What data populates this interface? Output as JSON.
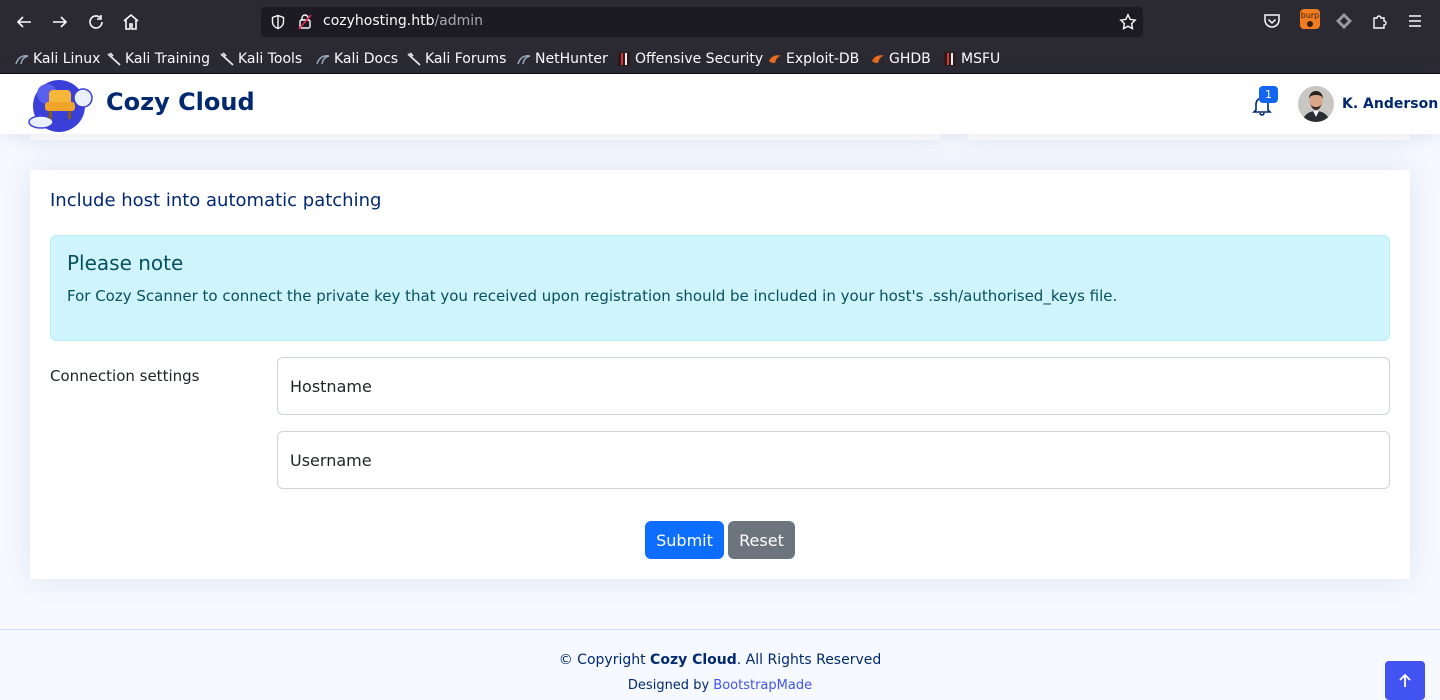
{
  "browser": {
    "url_host": "cozyhosting.htb",
    "url_path": "/admin",
    "bookmarks": [
      {
        "label": "Kali Linux",
        "icon": "kali-dragon-icon"
      },
      {
        "label": "Kali Training",
        "icon": "kali-dragon-icon"
      },
      {
        "label": "Kali Tools",
        "icon": "kali-dragon-icon"
      },
      {
        "label": "Kali Docs",
        "icon": "kali-dragon-icon"
      },
      {
        "label": "Kali Forums",
        "icon": "kali-dragon-icon"
      },
      {
        "label": "NetHunter",
        "icon": "kali-dragon-icon"
      },
      {
        "label": "Offensive Security",
        "icon": "offsec-icon"
      },
      {
        "label": "Exploit-DB",
        "icon": "exploitdb-icon"
      },
      {
        "label": "GHDB",
        "icon": "exploitdb-icon"
      },
      {
        "label": "MSFU",
        "icon": "offsec-icon"
      }
    ]
  },
  "header": {
    "brand": "Cozy Cloud",
    "notification_count": "1",
    "user_name": "K. Anderson"
  },
  "card": {
    "title": "Include host into automatic patching",
    "alert_heading": "Please note",
    "alert_text": "For Cozy Scanner to connect the private key that you received upon registration should be included in your host's .ssh/authorised_keys file.",
    "connection_label": "Connection settings",
    "hostname_placeholder": "Hostname",
    "username_placeholder": "Username",
    "submit_label": "Submit",
    "reset_label": "Reset"
  },
  "footer": {
    "copyright_prefix": "© Copyright ",
    "copyright_brand": "Cozy Cloud",
    "copyright_suffix": ". All Rights Reserved",
    "designed_by": "Designed by ",
    "designer": "BootstrapMade"
  },
  "colors": {
    "brand": "#012970",
    "primary": "#0d6efd",
    "secondary": "#6c757d",
    "alert_bg": "#cff4fc",
    "accent": "#4154f1"
  }
}
